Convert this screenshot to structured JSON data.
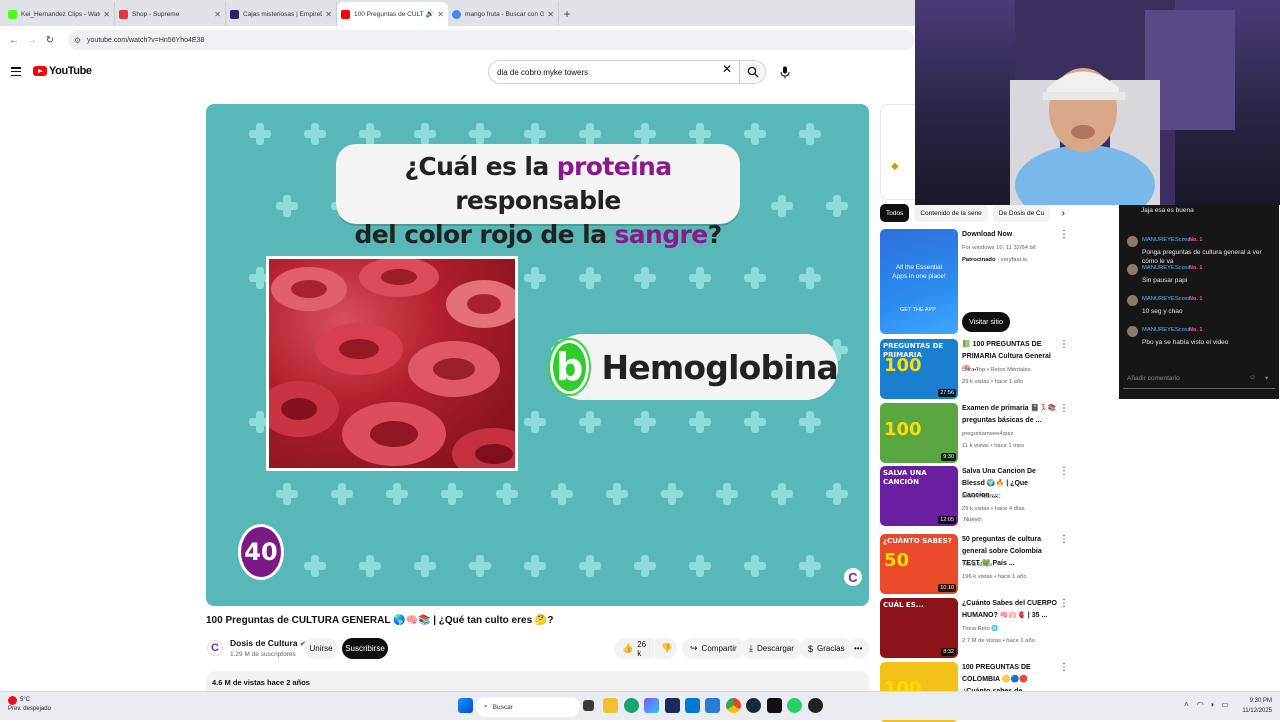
{
  "browser": {
    "tabs": [
      {
        "title": "Kei_Hernandez Clips - Watch L",
        "favicon_color": "#53fc18",
        "active": false
      },
      {
        "title": "Shop - Supreme",
        "favicon_color": "#e8343a",
        "active": false
      },
      {
        "title": "Cajas misteriosas | EmpireDrop",
        "favicon_color": "#2c1f6b",
        "active": false
      },
      {
        "title": "100 Preguntas de CULTURA",
        "favicon_color": "#ff0000",
        "active": true
      },
      {
        "title": "mango fruta - Buscar con Goog",
        "favicon_color": "#4285f4",
        "active": false
      }
    ],
    "url": "youtube.com/watch?v=Hn56Yho4E38"
  },
  "youtube": {
    "logo_text": "YouTube",
    "search_value": "dia de cobro myke towers"
  },
  "video": {
    "question_prefix": "¿Cuál es la ",
    "question_hl1": "proteína",
    "question_mid": " responsable",
    "question_line2_prefix": "del color rojo de la ",
    "question_hl2": "sangre",
    "question_suffix": "?",
    "answer_letter": "b",
    "answer_text": "Hemoglobina",
    "counter": "40",
    "watermark": "C"
  },
  "meta": {
    "title": "100 Preguntas de CULTURA GENERAL 🌎🧠📚 | ¿Qué tan culto eres 🤔?",
    "channel_name": "Dosis de Cultura",
    "subscribers": "1.29 M de suscriptores",
    "join_label": "Unirse",
    "subscribe_label": "Suscribirse",
    "like_count": "26 k",
    "share_label": "Compartir",
    "download_label": "Descargar",
    "thanks_label": "Gracias",
    "views_date": "4.6 M de vistas  hace 2 años"
  },
  "sidebar": {
    "chips": [
      "Todos",
      "Contenido de la serie",
      "De Dosis de Cu"
    ],
    "ad": {
      "title": "Download Now",
      "subtitle": "For windows 10, 11 32/64 bit",
      "sponsor_label": "Patrocinado",
      "sponsor_domain": "· veryfast.io",
      "thumb_text": "All the Essential Apps in one place!",
      "thumb_cta": "GET THE APP",
      "visit_label": "Visitar sitio"
    },
    "recs": [
      {
        "title": "📗 100 PREGUNTAS DE PRIMARIA Cultura General 🧠 ...",
        "channel": "Ultra Top • Retos Mentales",
        "meta": "29 k vistas • hace 1 año",
        "duration": "27:56",
        "thumb_label": "PREGUNTAS DE PRIMARIA",
        "thumb_big": "100",
        "thumb_color": "#1b7fd0"
      },
      {
        "title": "Examen de primaria 📓🏃📚 preguntas básicas de ...",
        "channel": "preguntameee4quiz",
        "meta": "11 k vistas • hace 1 mes",
        "duration": "9:30",
        "thumb_label": "",
        "thumb_big": "100",
        "thumb_color": "#5aa640"
      },
      {
        "title": "Salva Una Cancion De Blessd 🌍🔥 | ¿Que Cancion ...",
        "channel": "BRAHYMUSIC",
        "meta": "29 k vistas • hace 4 días",
        "duration": "12:05",
        "thumb_label": "SALVA UNA CANCIÓN",
        "thumb_big": "",
        "thumb_color": "#6a1fa0",
        "badge": "Nuevo"
      },
      {
        "title": "50 preguntas de cultura general sobre Colombia TEST 💚 País ...",
        "channel": "Trivia Mega",
        "meta": "196 k vistas • hace 1 año",
        "duration": "10:10",
        "thumb_label": "¿CUÁNTO SABES?",
        "thumb_big": "50",
        "thumb_color": "#e84a2a"
      },
      {
        "title": "¿Cuánto Sabes del CUERPO HUMANO? 🧠🫁🫀 | 35 ...",
        "channel": "Trivia Reto 🌐",
        "meta": "2.7 M de vistas • hace 1 año",
        "duration": "8:32",
        "thumb_label": "CUÁL ES...",
        "thumb_big": "",
        "thumb_color": "#8c1418"
      },
      {
        "title": "100 PREGUNTAS DE COLOMBIA 🟡🔵🔴 ¿Cuánto sabes de ...",
        "channel": "",
        "meta": "",
        "duration": "",
        "thumb_label": "",
        "thumb_big": "100",
        "thumb_color": "#f2c218"
      }
    ]
  },
  "chat": {
    "messages": [
      {
        "user": "",
        "badge": "",
        "text": "Jaja esa es buena"
      },
      {
        "user": "MANUREYEScoss",
        "badge": "No. 1",
        "text": "Ponga preguntas de cultura general a ver cómo le va"
      },
      {
        "user": "MANUREYEScoss",
        "badge": "No. 1",
        "text": "Sin pausar papi"
      },
      {
        "user": "MANUREYEScoss",
        "badge": "No. 1",
        "text": "10 seg y chao"
      },
      {
        "user": "MANUREYEScoss",
        "badge": "No. 1",
        "text": "Pbo ya se había visto el video"
      }
    ],
    "input_placeholder": "Añadir comentario"
  },
  "taskbar": {
    "temperature": "5°C",
    "weather_desc": "Prev. despejado",
    "search_label": "Buscar",
    "time": "9:30 PM",
    "date": "11/12/2025"
  }
}
